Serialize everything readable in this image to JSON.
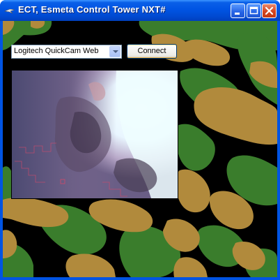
{
  "window": {
    "title": "ECT, Esmeta Control Tower NXT#",
    "titlebar_color": "#0054e3",
    "buttons": [
      "minimize-icon",
      "maximize-icon",
      "close-icon"
    ]
  },
  "toolbar": {
    "device_select": {
      "value": "Logitech QuickCam Web"
    },
    "connect_label": "Connect"
  },
  "background": {
    "pattern": "camouflage",
    "colors": {
      "green": "#3a7d2c",
      "tan": "#b18a3c",
      "black": "#000000"
    }
  },
  "video": {
    "content": "webcam-feed"
  }
}
